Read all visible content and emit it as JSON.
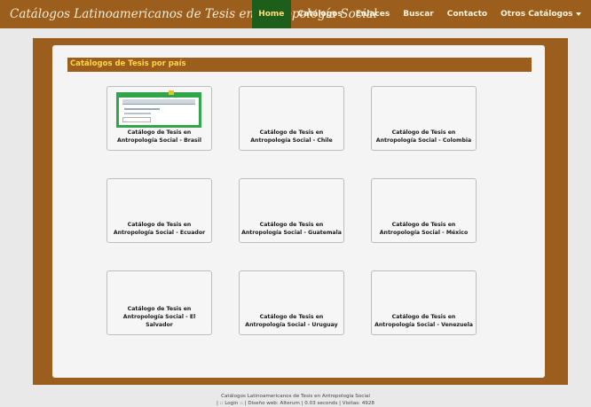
{
  "header": {
    "brand": "Catálogos Latinoamericanos de Tesis en Antropología Social",
    "nav": [
      {
        "label": "Home",
        "active": true
      },
      {
        "label": "Catálogos"
      },
      {
        "label": "Enlaces"
      },
      {
        "label": "Buscar"
      },
      {
        "label": "Contacto"
      },
      {
        "label": "Otros Catálogos"
      }
    ]
  },
  "main": {
    "heading": "Catálogos de Tesis por país",
    "cards": [
      {
        "title": "Catálogo de Tesis en Antropología Social - Brasil"
      },
      {
        "title": "Catálogo de Tesis en Antropología Social - Chile"
      },
      {
        "title": "Catálogo de Tesis en Antropología Social - Colombia"
      },
      {
        "title": "Catálogo de Tesis en Antropología Social - Ecuador"
      },
      {
        "title": "Catálogo de Tesis en Antropología Social - Guatemala"
      },
      {
        "title": "Catálogo de Tesis en Antropología Social - México"
      },
      {
        "title": "Catálogo de Tesis en Antropología Social - El Salvador"
      },
      {
        "title": "Catálogo de Tesis en Antropología Social - Uruguay"
      },
      {
        "title": "Catálogo de Tesis en Antropología Social - Venezuela"
      }
    ]
  },
  "footer": {
    "line1": "Catálogos Latinoamericanos de Tesis en Antropología Social",
    "line2": "| :: Login :: | Diseño web: Alterum | 0.03 seconds | Visitas: 4928"
  },
  "colors": {
    "brand_brown": "#9c5e1c",
    "active_green": "#1d5e1b",
    "heading_yellow": "#ffd54a"
  }
}
